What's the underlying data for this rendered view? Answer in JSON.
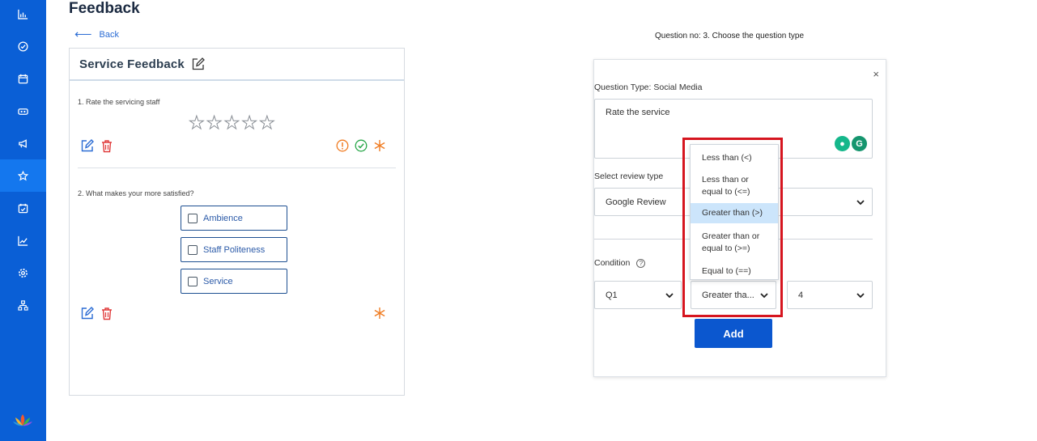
{
  "page": {
    "title": "Feedback",
    "back_label": "Back"
  },
  "form": {
    "title": "Service Feedback",
    "questions": [
      {
        "label": "1. Rate the servicing staff",
        "stars": 5
      },
      {
        "label": "2. What makes your more satisfied?",
        "options": [
          "Ambience",
          "Staff Politeness",
          "Service"
        ]
      }
    ]
  },
  "editor": {
    "heading": "Question no: 3. Choose the question type",
    "question_type_label": "Question Type: Social Media",
    "question_text": "Rate the service",
    "review_type_label": "Select review type",
    "review_type_value": "Google Review",
    "condition_label": "Condition",
    "condition_question": "Q1",
    "condition_operator": "Greater tha...",
    "condition_value": "4",
    "add_label": "Add",
    "close_symbol": "×"
  },
  "dropdown": {
    "options": [
      {
        "label": "Less than (<)",
        "selected": false
      },
      {
        "label": "Less than or equal to (<=)",
        "selected": false
      },
      {
        "label": "Greater than (>)",
        "selected": true
      },
      {
        "label": "Greater than or equal to (>=)",
        "selected": false
      },
      {
        "label": "Equal to (==)",
        "selected": false
      }
    ]
  },
  "sidebar": {
    "items": [
      {
        "icon": "bar-chart-icon"
      },
      {
        "icon": "check-circle-icon"
      },
      {
        "icon": "calendar-icon"
      },
      {
        "icon": "users-icon"
      },
      {
        "icon": "megaphone-icon"
      },
      {
        "icon": "star-icon",
        "active": true
      },
      {
        "icon": "calendar-check-icon"
      },
      {
        "icon": "line-chart-icon"
      },
      {
        "icon": "settings-icon"
      },
      {
        "icon": "hierarchy-icon"
      }
    ]
  },
  "colors": {
    "sidebar": "#0a5fd6",
    "sidebar_active": "#1477ee",
    "accent": "#0b57cf",
    "highlight": "#d6151f",
    "warning": "#f07c22",
    "success": "#2aa84a",
    "danger": "#e03a3a"
  }
}
